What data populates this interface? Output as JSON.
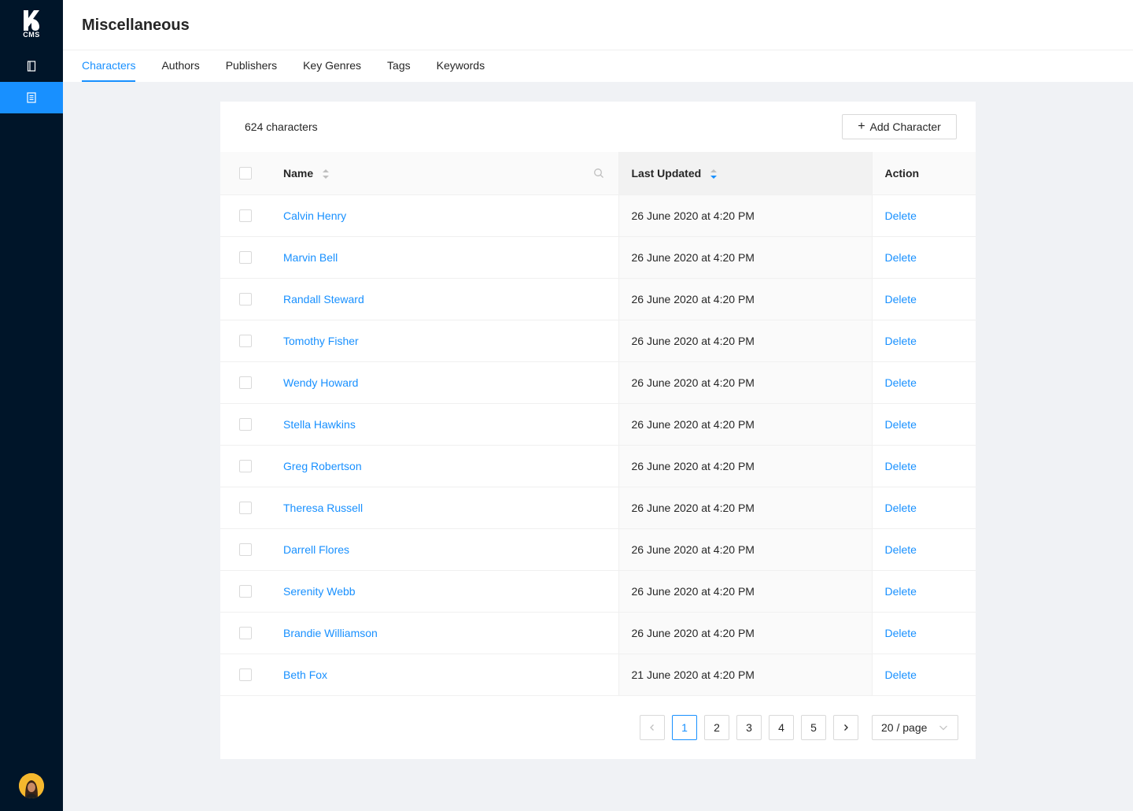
{
  "sidebar": {
    "logo_text": "CMS",
    "nav": [
      {
        "icon": "book-icon"
      },
      {
        "icon": "document-icon",
        "active": true
      }
    ],
    "avatar_icon": "user-avatar"
  },
  "header": {
    "title": "Miscellaneous",
    "tabs": [
      {
        "label": "Characters",
        "active": true
      },
      {
        "label": "Authors"
      },
      {
        "label": "Publishers"
      },
      {
        "label": "Key Genres"
      },
      {
        "label": "Tags"
      },
      {
        "label": "Keywords"
      }
    ]
  },
  "list": {
    "count_label": "624 characters",
    "add_button": "Add Character",
    "columns": {
      "name": "Name",
      "updated": "Last Updated",
      "action": "Action"
    },
    "rows": [
      {
        "name": "Calvin Henry",
        "updated": "26 June 2020 at 4:20 PM",
        "action": "Delete"
      },
      {
        "name": "Marvin Bell",
        "updated": "26 June 2020 at 4:20 PM",
        "action": "Delete"
      },
      {
        "name": "Randall Steward",
        "updated": "26 June 2020 at 4:20 PM",
        "action": "Delete"
      },
      {
        "name": "Tomothy Fisher",
        "updated": "26 June 2020 at 4:20 PM",
        "action": "Delete"
      },
      {
        "name": "Wendy Howard",
        "updated": "26 June 2020 at 4:20 PM",
        "action": "Delete"
      },
      {
        "name": "Stella Hawkins",
        "updated": "26 June 2020 at 4:20 PM",
        "action": "Delete"
      },
      {
        "name": "Greg Robertson",
        "updated": "26 June 2020 at 4:20 PM",
        "action": "Delete"
      },
      {
        "name": "Theresa Russell",
        "updated": "26 June 2020 at 4:20 PM",
        "action": "Delete"
      },
      {
        "name": "Darrell Flores",
        "updated": "26 June 2020 at 4:20 PM",
        "action": "Delete"
      },
      {
        "name": "Serenity Webb",
        "updated": "26 June 2020 at 4:20 PM",
        "action": "Delete"
      },
      {
        "name": "Brandie Williamson",
        "updated": "26 June 2020 at 4:20 PM",
        "action": "Delete"
      },
      {
        "name": "Beth Fox",
        "updated": "21 June 2020 at 4:20 PM",
        "action": "Delete"
      }
    ]
  },
  "pagination": {
    "pages": [
      "1",
      "2",
      "3",
      "4",
      "5"
    ],
    "current": "1",
    "page_size": "20 / page"
  },
  "colors": {
    "sidebar_bg": "#001529",
    "accent": "#1890ff",
    "page_bg": "#f0f2f5"
  }
}
